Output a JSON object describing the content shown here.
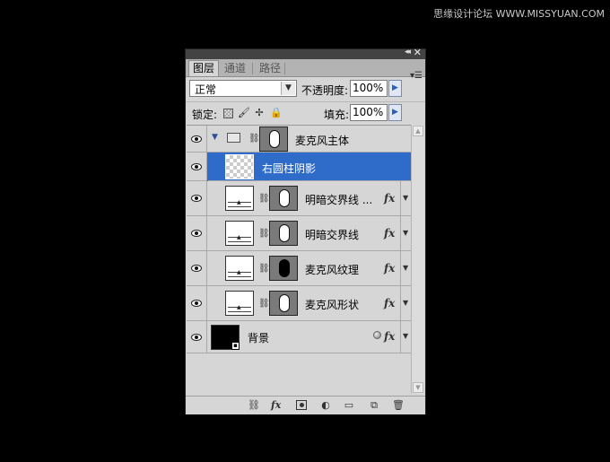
{
  "watermark": "思缘设计论坛 WWW.MISSYUAN.COM",
  "titlebar": {
    "collapse_label": "◂◂",
    "close_label": "✕"
  },
  "tabs": [
    {
      "label": "图层"
    },
    {
      "label": "通道"
    },
    {
      "label": "路径"
    }
  ],
  "blend_mode": {
    "value": "正常"
  },
  "opacity": {
    "label": "不透明度:",
    "value": "100%"
  },
  "lock": {
    "label": "锁定:"
  },
  "fill": {
    "label": "填充:",
    "value": "100%"
  },
  "layers": [
    {
      "name": "麦克风主体",
      "type": "group",
      "expanded": true,
      "has_mask": true,
      "mask_style": "white-pill"
    },
    {
      "name": "右圆柱阴影",
      "type": "layer",
      "selected": true,
      "thumb": "transparent"
    },
    {
      "name": "明暗交界线 ...",
      "type": "layer",
      "has_mask": true,
      "mask_style": "white-pill",
      "fx": true
    },
    {
      "name": "明暗交界线",
      "type": "layer",
      "has_mask": true,
      "mask_style": "white-pill",
      "fx": true
    },
    {
      "name": "麦克风纹理",
      "type": "layer",
      "has_mask": true,
      "mask_style": "black-pill",
      "fx": true
    },
    {
      "name": "麦克风形状",
      "type": "layer",
      "has_mask": true,
      "mask_style": "white-pill",
      "fx": true
    },
    {
      "name": "背景",
      "type": "background",
      "fx": true,
      "locked": true
    }
  ],
  "fx_label": "fx",
  "colors": {
    "selection": "#2f6cc9",
    "panel_bg": "#d6d6d6",
    "app_bg": "#000000"
  }
}
